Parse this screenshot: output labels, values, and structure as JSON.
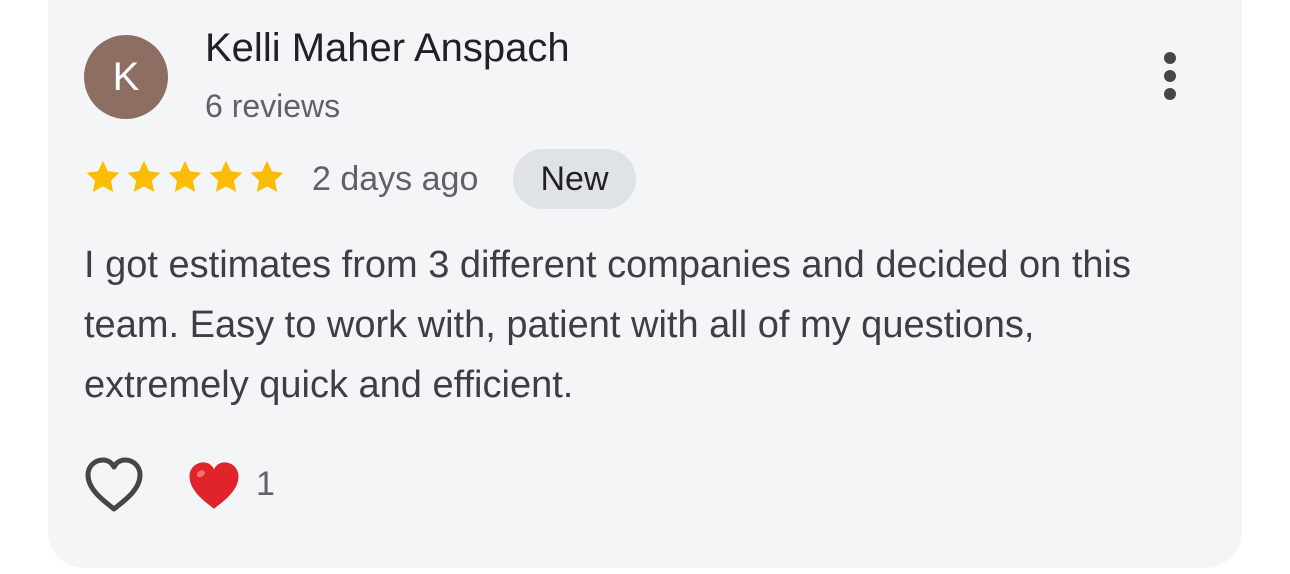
{
  "review": {
    "avatar_initial": "K",
    "author_name": "Kelli Maher Anspach",
    "author_reviews": "6 reviews",
    "rating": 5,
    "rating_max": 5,
    "time_ago": "2 days ago",
    "badge": "New",
    "text": "I got estimates from 3 different companies and decided on this team. Easy to work with, patient with all of my questions, extremely quick and efficient.",
    "reaction_count": "1"
  },
  "icons": {
    "more": "more-vert-icon",
    "star": "star-icon",
    "like": "heart-outline-icon",
    "reaction": "red-heart-emoji-icon"
  },
  "colors": {
    "card_bg": "#f4f5f7",
    "avatar_bg": "#8d6e63",
    "star": "#fbbc04",
    "badge_bg": "#dfe2e6",
    "reaction_heart": "#e0242b"
  }
}
